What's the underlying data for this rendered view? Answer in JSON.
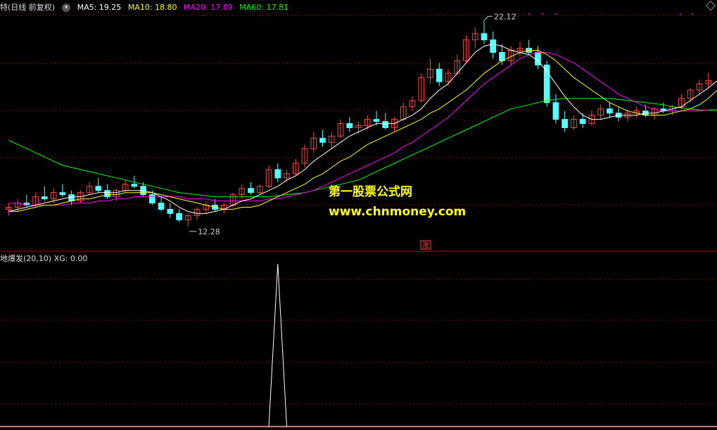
{
  "header": {
    "title": "特(日线 前复权)",
    "ma5": "MA5: 19.25",
    "ma10": "MA10: 18.80",
    "ma20": "MA20: 17.89",
    "ma60": "MA60: 17.81"
  },
  "subpanel": {
    "label": "地爆发(20,10)",
    "xg": "XG: 0.00"
  },
  "annotations": {
    "high": "22.12",
    "low": "12.28",
    "rise_mark": "涨"
  },
  "watermark": {
    "line1": "第一股票公式网",
    "line2": "www.chnmoney.com"
  },
  "colors": {
    "bg": "#000000",
    "up": "#FF4444",
    "down": "#54FFFF",
    "ma5": "#FFFFFF",
    "ma10": "#FFFF00",
    "ma20": "#FF00FF",
    "ma60": "#00FF00",
    "grid": "#8B0000",
    "watermark": "#FFFF00"
  },
  "chart_data": {
    "type": "candlestick",
    "price_range": [
      11.5,
      22.5
    ],
    "candles": [
      {
        "o": 13.1,
        "h": 13.4,
        "l": 12.8,
        "c": 13.2
      },
      {
        "o": 13.2,
        "h": 13.6,
        "l": 13.0,
        "c": 13.4
      },
      {
        "o": 13.4,
        "h": 13.8,
        "l": 13.2,
        "c": 13.3
      },
      {
        "o": 13.3,
        "h": 13.9,
        "l": 13.2,
        "c": 13.7
      },
      {
        "o": 13.7,
        "h": 14.2,
        "l": 13.5,
        "c": 13.6
      },
      {
        "o": 13.6,
        "h": 14.1,
        "l": 13.4,
        "c": 13.9
      },
      {
        "o": 13.9,
        "h": 14.3,
        "l": 13.7,
        "c": 13.8
      },
      {
        "o": 13.8,
        "h": 14.0,
        "l": 13.3,
        "c": 13.5
      },
      {
        "o": 13.5,
        "h": 14.0,
        "l": 13.4,
        "c": 13.9
      },
      {
        "o": 13.9,
        "h": 14.4,
        "l": 13.8,
        "c": 14.2
      },
      {
        "o": 14.2,
        "h": 14.6,
        "l": 13.9,
        "c": 14.0
      },
      {
        "o": 14.0,
        "h": 14.3,
        "l": 13.6,
        "c": 13.7
      },
      {
        "o": 13.7,
        "h": 14.1,
        "l": 13.5,
        "c": 14.0
      },
      {
        "o": 14.0,
        "h": 14.5,
        "l": 13.9,
        "c": 14.3
      },
      {
        "o": 14.3,
        "h": 14.7,
        "l": 14.1,
        "c": 14.2
      },
      {
        "o": 14.2,
        "h": 14.4,
        "l": 13.7,
        "c": 13.8
      },
      {
        "o": 13.8,
        "h": 14.0,
        "l": 13.3,
        "c": 13.4
      },
      {
        "o": 13.4,
        "h": 13.7,
        "l": 13.0,
        "c": 13.1
      },
      {
        "o": 13.1,
        "h": 13.4,
        "l": 12.7,
        "c": 12.9
      },
      {
        "o": 12.9,
        "h": 13.1,
        "l": 12.5,
        "c": 12.6
      },
      {
        "o": 12.6,
        "h": 12.9,
        "l": 12.28,
        "c": 12.8
      },
      {
        "o": 12.8,
        "h": 13.2,
        "l": 12.6,
        "c": 13.1
      },
      {
        "o": 13.1,
        "h": 13.5,
        "l": 12.9,
        "c": 13.3
      },
      {
        "o": 13.3,
        "h": 13.6,
        "l": 13.0,
        "c": 13.1
      },
      {
        "o": 13.1,
        "h": 13.4,
        "l": 12.9,
        "c": 13.3
      },
      {
        "o": 13.3,
        "h": 13.9,
        "l": 13.2,
        "c": 13.8
      },
      {
        "o": 13.8,
        "h": 14.3,
        "l": 13.6,
        "c": 14.1
      },
      {
        "o": 14.1,
        "h": 14.4,
        "l": 13.8,
        "c": 13.9
      },
      {
        "o": 13.9,
        "h": 14.3,
        "l": 13.8,
        "c": 14.2
      },
      {
        "o": 14.2,
        "h": 15.2,
        "l": 14.1,
        "c": 15.0
      },
      {
        "o": 15.0,
        "h": 15.3,
        "l": 14.4,
        "c": 14.6
      },
      {
        "o": 14.6,
        "h": 15.0,
        "l": 14.4,
        "c": 14.8
      },
      {
        "o": 14.8,
        "h": 15.5,
        "l": 14.7,
        "c": 15.3
      },
      {
        "o": 15.3,
        "h": 16.2,
        "l": 15.1,
        "c": 16.0
      },
      {
        "o": 16.0,
        "h": 16.8,
        "l": 15.8,
        "c": 16.5
      },
      {
        "o": 16.5,
        "h": 16.9,
        "l": 16.1,
        "c": 16.3
      },
      {
        "o": 16.3,
        "h": 16.8,
        "l": 16.0,
        "c": 16.6
      },
      {
        "o": 16.6,
        "h": 17.4,
        "l": 16.5,
        "c": 17.2
      },
      {
        "o": 17.2,
        "h": 17.5,
        "l": 16.8,
        "c": 17.0
      },
      {
        "o": 17.0,
        "h": 17.3,
        "l": 16.7,
        "c": 17.1
      },
      {
        "o": 17.1,
        "h": 17.6,
        "l": 16.9,
        "c": 17.4
      },
      {
        "o": 17.4,
        "h": 17.8,
        "l": 17.1,
        "c": 17.3
      },
      {
        "o": 17.3,
        "h": 17.7,
        "l": 16.9,
        "c": 17.0
      },
      {
        "o": 17.0,
        "h": 17.5,
        "l": 16.8,
        "c": 17.4
      },
      {
        "o": 17.4,
        "h": 18.2,
        "l": 17.3,
        "c": 18.0
      },
      {
        "o": 18.0,
        "h": 18.5,
        "l": 17.8,
        "c": 18.3
      },
      {
        "o": 18.3,
        "h": 19.6,
        "l": 18.2,
        "c": 19.4
      },
      {
        "o": 19.4,
        "h": 20.3,
        "l": 19.1,
        "c": 19.8
      },
      {
        "o": 19.8,
        "h": 20.1,
        "l": 19.0,
        "c": 19.2
      },
      {
        "o": 19.2,
        "h": 19.8,
        "l": 19.0,
        "c": 19.6
      },
      {
        "o": 19.6,
        "h": 20.5,
        "l": 19.5,
        "c": 20.2
      },
      {
        "o": 20.2,
        "h": 21.4,
        "l": 20.1,
        "c": 21.2
      },
      {
        "o": 21.2,
        "h": 21.8,
        "l": 20.8,
        "c": 21.5
      },
      {
        "o": 21.5,
        "h": 22.12,
        "l": 21.0,
        "c": 21.2
      },
      {
        "o": 21.2,
        "h": 21.6,
        "l": 20.3,
        "c": 20.6
      },
      {
        "o": 20.6,
        "h": 21.0,
        "l": 20.0,
        "c": 20.2
      },
      {
        "o": 20.2,
        "h": 20.9,
        "l": 20.0,
        "c": 20.7
      },
      {
        "o": 20.7,
        "h": 21.1,
        "l": 20.4,
        "c": 20.8
      },
      {
        "o": 20.8,
        "h": 21.2,
        "l": 20.5,
        "c": 20.6
      },
      {
        "o": 20.6,
        "h": 20.9,
        "l": 19.8,
        "c": 20.0
      },
      {
        "o": 20.0,
        "h": 20.2,
        "l": 18.0,
        "c": 18.2
      },
      {
        "o": 18.2,
        "h": 18.6,
        "l": 17.2,
        "c": 17.4
      },
      {
        "o": 17.4,
        "h": 17.8,
        "l": 16.8,
        "c": 17.0
      },
      {
        "o": 17.0,
        "h": 17.6,
        "l": 16.9,
        "c": 17.4
      },
      {
        "o": 17.4,
        "h": 17.7,
        "l": 17.0,
        "c": 17.2
      },
      {
        "o": 17.2,
        "h": 17.8,
        "l": 17.1,
        "c": 17.6
      },
      {
        "o": 17.6,
        "h": 18.1,
        "l": 17.4,
        "c": 17.9
      },
      {
        "o": 17.9,
        "h": 18.2,
        "l": 17.5,
        "c": 17.7
      },
      {
        "o": 17.7,
        "h": 18.0,
        "l": 17.3,
        "c": 17.5
      },
      {
        "o": 17.5,
        "h": 17.9,
        "l": 17.3,
        "c": 17.7
      },
      {
        "o": 17.7,
        "h": 18.0,
        "l": 17.5,
        "c": 17.8
      },
      {
        "o": 17.8,
        "h": 18.1,
        "l": 17.5,
        "c": 17.6
      },
      {
        "o": 17.6,
        "h": 18.0,
        "l": 17.4,
        "c": 17.9
      },
      {
        "o": 17.9,
        "h": 18.2,
        "l": 17.7,
        "c": 17.8
      },
      {
        "o": 17.8,
        "h": 18.1,
        "l": 17.6,
        "c": 18.0
      },
      {
        "o": 18.0,
        "h": 18.6,
        "l": 17.9,
        "c": 18.4
      },
      {
        "o": 18.4,
        "h": 18.9,
        "l": 18.2,
        "c": 18.8
      },
      {
        "o": 18.8,
        "h": 19.3,
        "l": 18.6,
        "c": 19.1
      },
      {
        "o": 19.1,
        "h": 19.6,
        "l": 18.9,
        "c": 19.25
      }
    ],
    "ma5": [
      13.0,
      13.1,
      13.2,
      13.3,
      13.4,
      13.5,
      13.6,
      13.7,
      13.7,
      13.8,
      13.9,
      13.9,
      13.9,
      14.0,
      14.0,
      14.0,
      13.9,
      13.7,
      13.5,
      13.2,
      13.0,
      12.9,
      12.9,
      13.0,
      13.1,
      13.3,
      13.5,
      13.6,
      13.8,
      14.0,
      14.2,
      14.5,
      14.7,
      15.0,
      15.4,
      15.7,
      16.0,
      16.3,
      16.6,
      16.8,
      17.0,
      17.2,
      17.2,
      17.2,
      17.4,
      17.6,
      17.9,
      18.4,
      18.8,
      19.1,
      19.6,
      20.1,
      20.6,
      20.9,
      21.0,
      20.9,
      20.7,
      20.6,
      20.5,
      20.2,
      19.7,
      19.1,
      18.5,
      18.0,
      17.6,
      17.4,
      17.4,
      17.5,
      17.6,
      17.6,
      17.6,
      17.7,
      17.7,
      17.8,
      17.9,
      18.0,
      18.3,
      18.6,
      18.9,
      19.25
    ],
    "ma10": [
      13.0,
      13.0,
      13.1,
      13.2,
      13.3,
      13.3,
      13.4,
      13.5,
      13.6,
      13.6,
      13.7,
      13.8,
      13.8,
      13.9,
      13.9,
      13.9,
      13.9,
      13.8,
      13.7,
      13.6,
      13.5,
      13.4,
      13.3,
      13.2,
      13.1,
      13.1,
      13.2,
      13.2,
      13.3,
      13.5,
      13.7,
      13.9,
      14.1,
      14.3,
      14.6,
      14.8,
      15.1,
      15.4,
      15.6,
      15.9,
      16.2,
      16.4,
      16.6,
      16.8,
      17.0,
      17.2,
      17.4,
      17.7,
      17.9,
      18.2,
      18.5,
      18.8,
      19.2,
      19.6,
      19.9,
      20.2,
      20.4,
      20.6,
      20.7,
      20.7,
      20.5,
      20.2,
      19.8,
      19.4,
      19.1,
      18.8,
      18.5,
      18.2,
      18.0,
      17.8,
      17.7,
      17.6,
      17.6,
      17.6,
      17.7,
      17.8,
      17.9,
      18.1,
      18.4,
      18.8
    ],
    "ma20": [
      13.4,
      13.4,
      13.3,
      13.3,
      13.3,
      13.3,
      13.3,
      13.4,
      13.4,
      13.4,
      13.5,
      13.5,
      13.6,
      13.6,
      13.7,
      13.7,
      13.7,
      13.7,
      13.7,
      13.7,
      13.6,
      13.6,
      13.6,
      13.5,
      13.5,
      13.5,
      13.5,
      13.5,
      13.5,
      13.6,
      13.6,
      13.7,
      13.8,
      13.9,
      14.0,
      14.2,
      14.4,
      14.6,
      14.8,
      15.0,
      15.2,
      15.4,
      15.6,
      15.8,
      16.1,
      16.3,
      16.6,
      16.9,
      17.2,
      17.5,
      17.9,
      18.3,
      18.7,
      19.1,
      19.4,
      19.7,
      20.0,
      20.3,
      20.5,
      20.6,
      20.6,
      20.5,
      20.3,
      20.1,
      19.8,
      19.5,
      19.2,
      18.9,
      18.6,
      18.4,
      18.2,
      18.0,
      17.9,
      17.8,
      17.8,
      17.8,
      17.8,
      17.8,
      17.85,
      17.89
    ],
    "ma60": [
      16.4,
      16.2,
      16.0,
      15.8,
      15.6,
      15.4,
      15.2,
      15.1,
      15.0,
      14.9,
      14.8,
      14.7,
      14.6,
      14.5,
      14.4,
      14.3,
      14.2,
      14.1,
      14.0,
      13.9,
      13.85,
      13.8,
      13.75,
      13.7,
      13.7,
      13.7,
      13.7,
      13.7,
      13.7,
      13.7,
      13.75,
      13.8,
      13.85,
      13.9,
      14.0,
      14.1,
      14.2,
      14.3,
      14.4,
      14.5,
      14.7,
      14.9,
      15.1,
      15.3,
      15.5,
      15.7,
      15.9,
      16.1,
      16.3,
      16.5,
      16.7,
      16.9,
      17.1,
      17.3,
      17.5,
      17.7,
      17.9,
      18.0,
      18.1,
      18.2,
      18.3,
      18.35,
      18.4,
      18.4,
      18.4,
      18.4,
      18.4,
      18.4,
      18.35,
      18.3,
      18.25,
      18.2,
      18.15,
      18.1,
      18.0,
      17.95,
      17.9,
      17.85,
      17.83,
      17.81
    ],
    "xg_signal_index": 30,
    "xg_range": [
      0,
      1
    ]
  }
}
